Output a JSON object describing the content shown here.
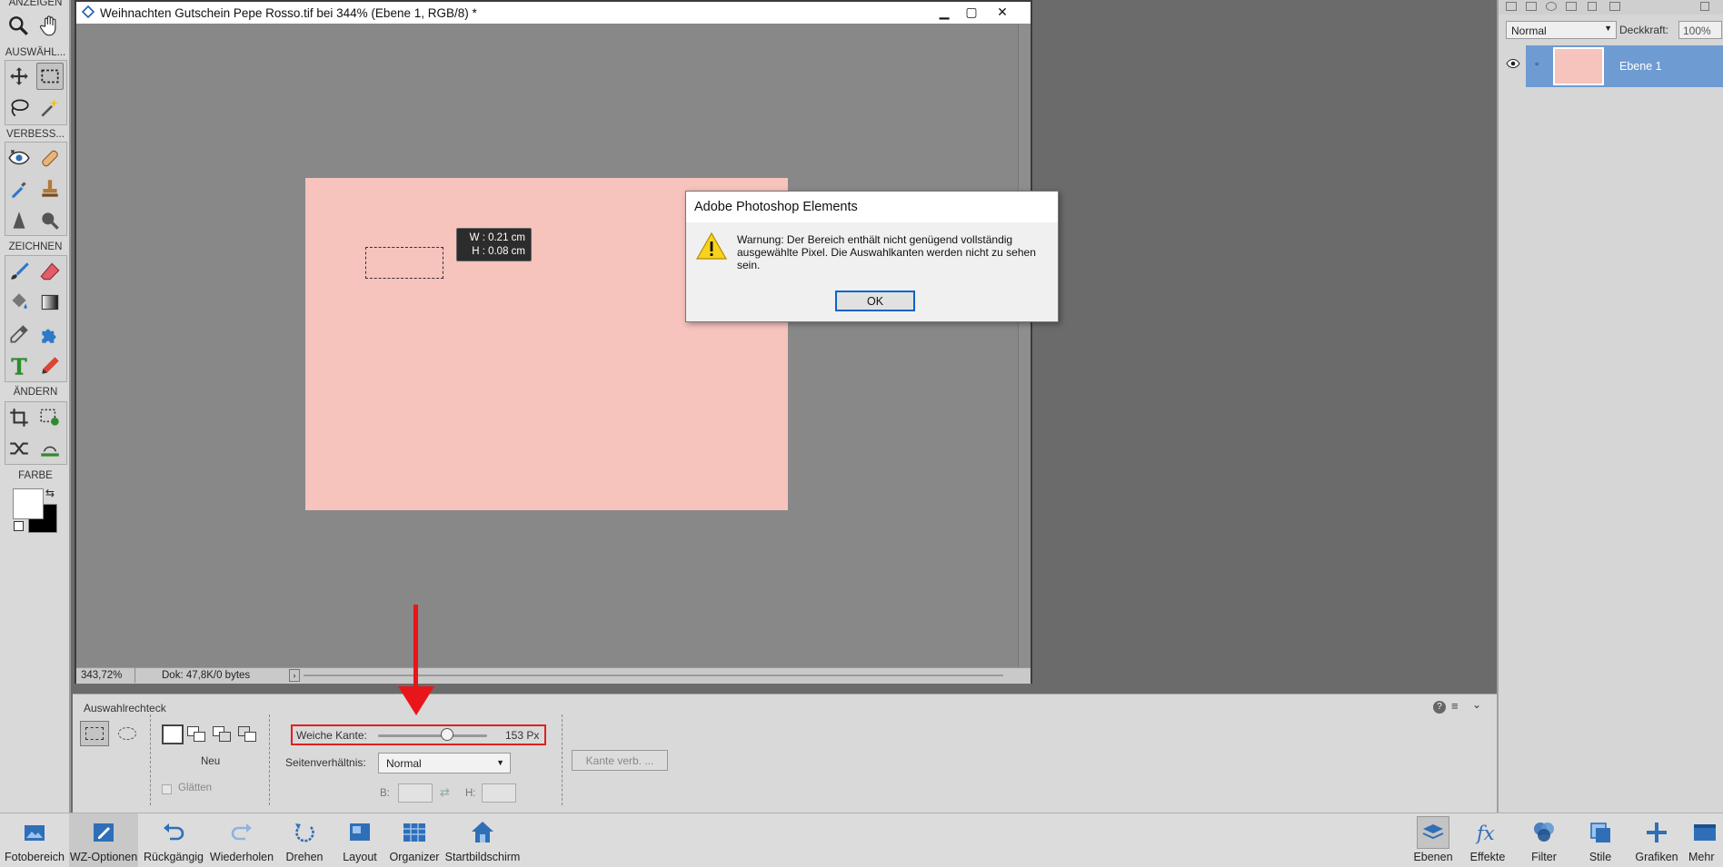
{
  "document": {
    "title": "Weihnachten Gutschein Pepe Rosso.tif bei 344% (Ebene 1, RGB/8) *",
    "zoom": "343,72%",
    "doc_info": "Dok: 47,8K/0 bytes",
    "canvas_color": "#f6c3bd",
    "size_tip": {
      "w": "W : 0.21 cm",
      "h": "H : 0.08 cm"
    }
  },
  "toolbox": {
    "sections": {
      "view": "ANZEIGEN",
      "select": "AUSWÄHL...",
      "enhance": "VERBESS...",
      "draw": "ZEICHNEN",
      "modify": "ÄNDERN",
      "color": "FARBE"
    }
  },
  "dialog": {
    "title": "Adobe Photoshop Elements",
    "message": "Warnung: Der Bereich enthält nicht genügend vollständig ausgewählte Pixel. Die Auswahlkanten werden nicht zu sehen sein.",
    "ok_label": "OK"
  },
  "layers": {
    "blend_mode": "Normal",
    "opacity_label": "Deckkraft:",
    "opacity_value": "100%",
    "layer_name": "Ebene 1",
    "selected_color": "#6e9bd2"
  },
  "options": {
    "tool_name": "Auswahlrechteck",
    "mode_label": "Neu",
    "smooth_label": "Glätten",
    "feather_label": "Weiche Kante:",
    "feather_value": "153 Px",
    "feather_level": 0.63,
    "aspect_label": "Seitenverhältnis:",
    "aspect_value": "Normal",
    "width_label": "B:",
    "height_label": "H:",
    "refine_label": "Kante verb. ..."
  },
  "bottombar": {
    "left": [
      {
        "label": "Fotobereich",
        "icon": "photo-bin-icon"
      },
      {
        "label": "WZ-Optionen",
        "icon": "tool-options-icon"
      },
      {
        "label": "Rückgängig",
        "icon": "undo-icon"
      },
      {
        "label": "Wiederholen",
        "icon": "redo-icon"
      },
      {
        "label": "Drehen",
        "icon": "rotate-icon"
      },
      {
        "label": "Layout",
        "icon": "layout-icon"
      },
      {
        "label": "Organizer",
        "icon": "organizer-icon"
      },
      {
        "label": "Startbildschirm",
        "icon": "home-icon"
      }
    ],
    "right": [
      {
        "label": "Ebenen",
        "icon": "layers-icon"
      },
      {
        "label": "Effekte",
        "icon": "fx-icon"
      },
      {
        "label": "Filter",
        "icon": "filter-icon"
      },
      {
        "label": "Stile",
        "icon": "styles-icon"
      },
      {
        "label": "Grafiken",
        "icon": "graphics-icon"
      },
      {
        "label": "Mehr",
        "icon": "more-icon"
      }
    ]
  },
  "colors": {
    "annotation_red": "#e02020",
    "accent_blue": "#0a64c8"
  }
}
